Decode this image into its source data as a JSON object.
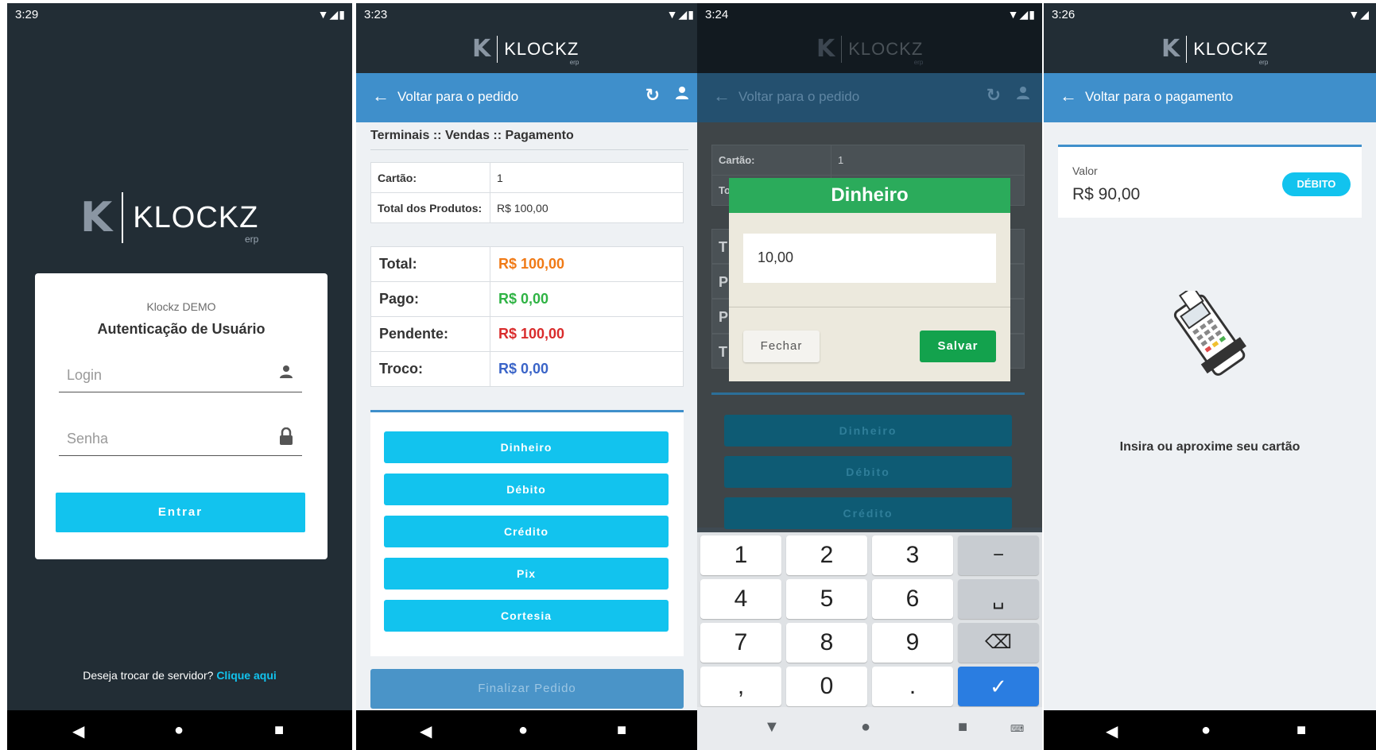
{
  "brand": {
    "logo_text": "KLOCKZ",
    "logo_sub": "erp",
    "logo_letter": "K",
    "accent": "#12c3ee",
    "toolbar_color": "#3f8fcb",
    "dark": "#222d35"
  },
  "phone1": {
    "time": "3:29",
    "status_icons": "▼◢▮",
    "card_title": "Klockz DEMO",
    "card_subtitle": "Autenticação de Usuário",
    "login_placeholder": "Login",
    "password_placeholder": "Senha",
    "enter_button": "Entrar",
    "server_text": "Deseja trocar de servidor?",
    "server_link": "Clique aqui"
  },
  "phone2": {
    "time": "3:23",
    "status_icons": "▼◢▮",
    "toolbar_back": "Voltar para o pedido",
    "breadcrumb": "Terminais :: Vendas :: Pagamento",
    "info_rows": [
      {
        "label": "Cartão:",
        "value": "1"
      },
      {
        "label": "Total dos Produtos:",
        "value": "R$ 100,00"
      }
    ],
    "totals": [
      {
        "label": "Total:",
        "value": "R$ 100,00",
        "color": "#f07a16"
      },
      {
        "label": "Pago:",
        "value": "R$ 0,00",
        "color": "#2fb344"
      },
      {
        "label": "Pendente:",
        "value": "R$ 100,00",
        "color": "#d92c2c"
      },
      {
        "label": "Troco:",
        "value": "R$ 0,00",
        "color": "#3a64c8"
      }
    ],
    "payment_buttons": [
      "Dinheiro",
      "Débito",
      "Crédito",
      "Pix",
      "Cortesia"
    ],
    "finalize_button": "Finalizar Pedido"
  },
  "phone3": {
    "time": "3:24",
    "status_icons": "▼◢▮",
    "toolbar_back": "Voltar para o pedido",
    "bg_row_label": "Cartão:",
    "bg_row_value": "1",
    "bg_row2_partial": "To",
    "bg_partials": [
      "T",
      "P",
      "P",
      "T"
    ],
    "bg_buttons": [
      "Dinheiro",
      "Débito",
      "Crédito"
    ],
    "dialog_title": "Dinheiro",
    "dialog_value": "10,00",
    "dialog_close": "Fechar",
    "dialog_save": "Salvar",
    "keys": [
      [
        "1",
        "2",
        "3",
        "−"
      ],
      [
        "4",
        "5",
        "6",
        "␣"
      ],
      [
        "7",
        "8",
        "9",
        "⌫"
      ],
      [
        ",",
        "0",
        ".",
        "✓"
      ]
    ]
  },
  "phone4": {
    "time": "3:26",
    "status_icons": "▼◢",
    "toolbar_back": "Voltar para o pagamento",
    "value_label": "Valor",
    "value_amount": "R$ 90,00",
    "badge": "DÉBITO",
    "instruction": "Insira ou aproxime seu cartão"
  },
  "navbar_icons": {
    "back": "◀",
    "home": "●",
    "recents": "■"
  }
}
